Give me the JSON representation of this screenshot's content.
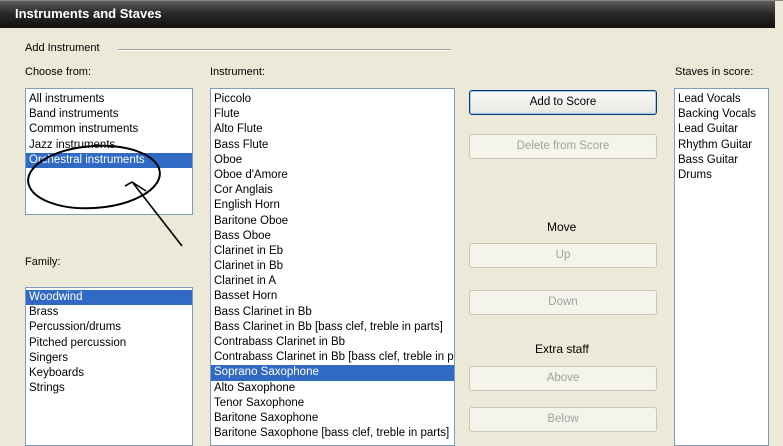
{
  "window": {
    "title": "Instruments and Staves"
  },
  "add_instrument": {
    "group_label": "Add Instrument"
  },
  "choose_from": {
    "label": "Choose from:",
    "items": [
      "All instruments",
      "Band instruments",
      "Common instruments",
      "Jazz instruments",
      "Orchestral instruments"
    ],
    "selected": "Orchestral instruments"
  },
  "family": {
    "label": "Family:",
    "items": [
      "Woodwind",
      "Brass",
      "Percussion/drums",
      "Pitched percussion",
      "Singers",
      "Keyboards",
      "Strings"
    ],
    "selected": "Woodwind"
  },
  "instrument": {
    "label": "Instrument:",
    "items": [
      "Piccolo",
      "Flute",
      "Alto Flute",
      "Bass Flute",
      "Oboe",
      "Oboe d'Amore",
      "Cor Anglais",
      "English Horn",
      "Baritone Oboe",
      "Bass Oboe",
      "Clarinet in Eb",
      "Clarinet in Bb",
      "Clarinet in A",
      "Basset Horn",
      "Bass Clarinet in Bb",
      "Bass Clarinet in Bb [bass clef, treble in parts]",
      "Contrabass Clarinet in Bb",
      "Contrabass Clarinet in Bb [bass clef, treble in parts]",
      "Soprano Saxophone",
      "Alto Saxophone",
      "Tenor Saxophone",
      "Baritone Saxophone",
      "Baritone Saxophone [bass clef, treble in parts]"
    ],
    "selected": "Soprano Saxophone"
  },
  "buttons": {
    "add_to_score": "Add to Score",
    "delete_from_score": "Delete from Score",
    "move_label": "Move",
    "up": "Up",
    "down": "Down",
    "extra_staff_label": "Extra staff",
    "above": "Above",
    "below": "Below"
  },
  "staves": {
    "label": "Staves in score:",
    "items": [
      "Lead Vocals",
      "Backing Vocals",
      "Lead Guitar",
      "Rhythm Guitar",
      "Bass Guitar",
      "Drums"
    ]
  },
  "colors": {
    "selection": "#316ac5",
    "annotation": "#000000"
  }
}
